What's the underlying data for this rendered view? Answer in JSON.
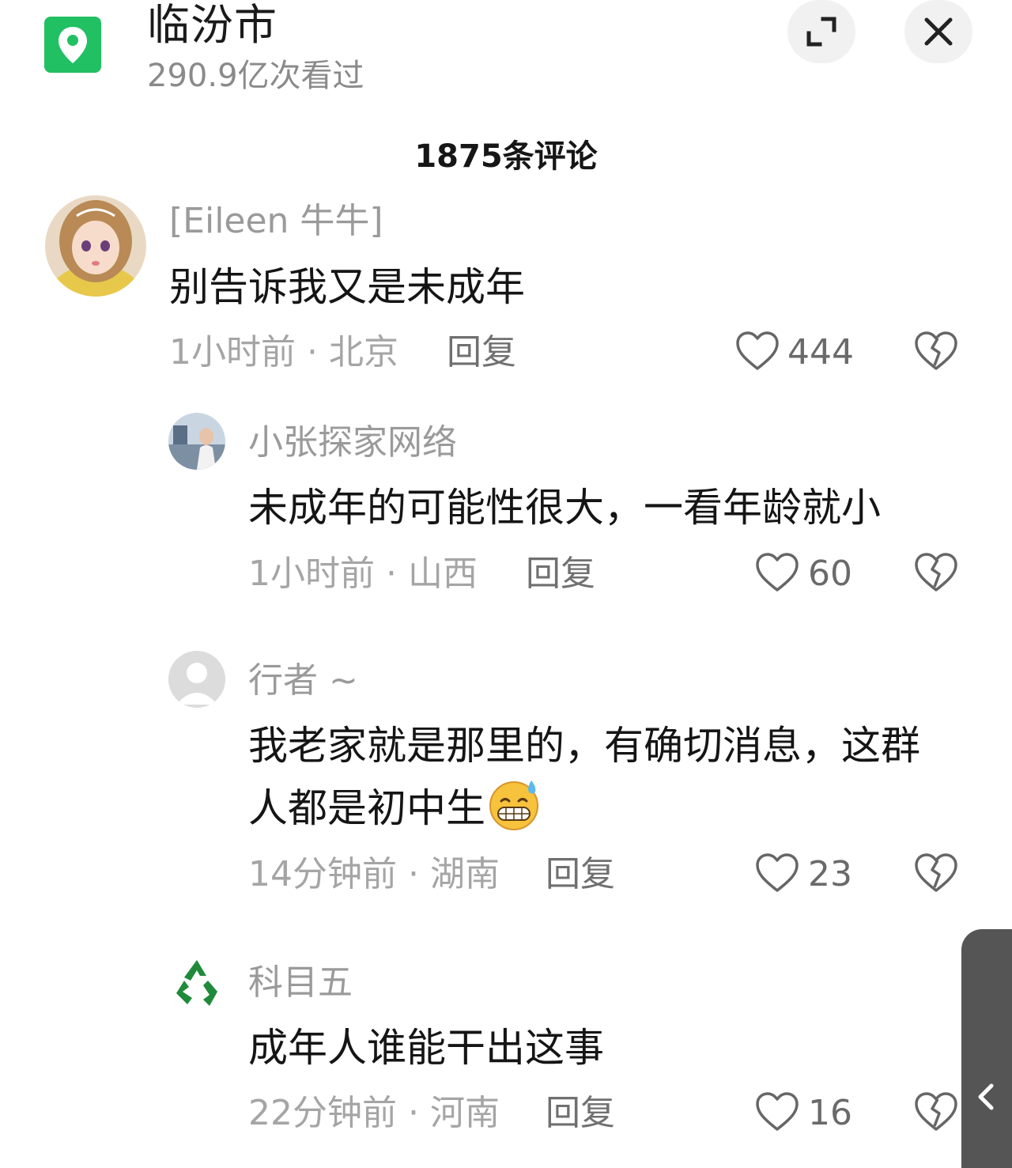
{
  "header": {
    "location_icon": "location-pin-icon",
    "title": "临汾市",
    "views": "290.9亿次看过",
    "expand_icon": "expand-icon",
    "close_icon": "close-icon"
  },
  "comments_panel": {
    "count_title": "1875条评论"
  },
  "comments": [
    {
      "username": "[Eileen 牛牛]",
      "content": "别告诉我又是未成年",
      "time": "1小时前",
      "region": "北京",
      "meta": "1小时前 · 北京",
      "reply_label": "回复",
      "likes": "444"
    },
    {
      "username": "小张探家网络",
      "content": "未成年的可能性很大，一看年龄就小",
      "time": "1小时前",
      "region": "山西",
      "meta": "1小时前 · 山西",
      "reply_label": "回复",
      "likes": "60"
    },
    {
      "username": "行者 ~",
      "content_line1": "我老家就是那里的，有确切消息，这群",
      "content_line2": "人都是初中生",
      "emoji": "grinning-sweat-emoji",
      "meta": "14分钟前 · 湖南",
      "reply_label": "回复",
      "likes": "23"
    },
    {
      "username": "科目五",
      "content": "成年人谁能干出这事",
      "meta": "22分钟前 · 河南",
      "reply_label": "回复",
      "likes": "16"
    }
  ],
  "icons": {
    "like": "heart-icon",
    "dislike": "broken-heart-icon",
    "collapse": "chevron-left-icon"
  },
  "colors": {
    "location_badge": "#21c063",
    "side_tab": "#555555"
  }
}
